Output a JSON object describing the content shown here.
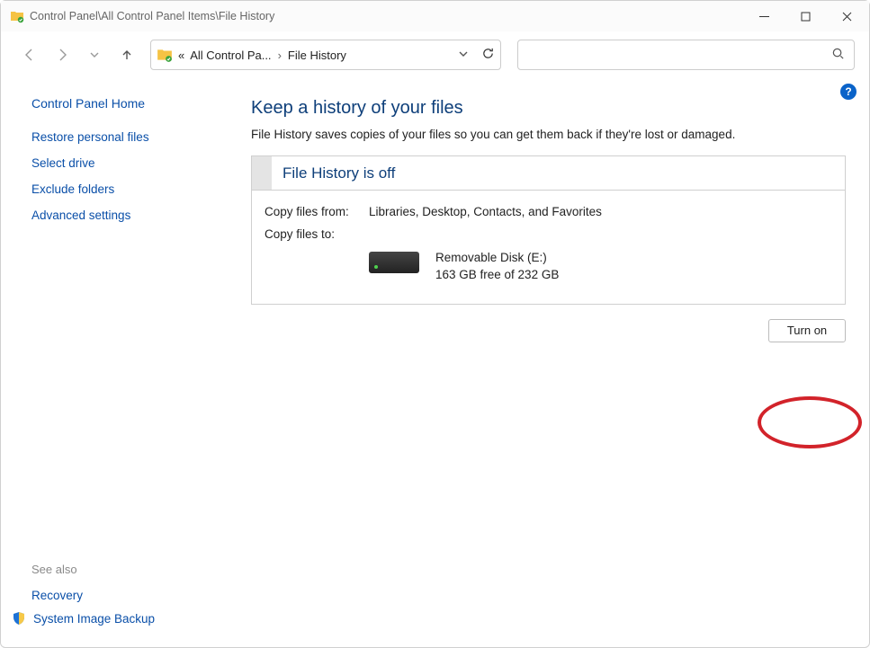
{
  "window": {
    "title": "Control Panel\\All Control Panel Items\\File History"
  },
  "breadcrumb": {
    "prefix": "«",
    "item1": "All Control Pa...",
    "item2": "File History"
  },
  "search": {
    "placeholder": ""
  },
  "sidebar": {
    "home": "Control Panel Home",
    "links": {
      "restore": "Restore personal files",
      "select_drive": "Select drive",
      "exclude": "Exclude folders",
      "advanced": "Advanced settings"
    },
    "see_also_label": "See also",
    "see_also": {
      "recovery": "Recovery",
      "sib": "System Image Backup"
    }
  },
  "content": {
    "heading": "Keep a history of your files",
    "description": "File History saves copies of your files so you can get them back if they're lost or damaged.",
    "status": "File History is off",
    "copy_from_label": "Copy files from:",
    "copy_from_value": "Libraries, Desktop, Contacts, and Favorites",
    "copy_to_label": "Copy files to:",
    "drive_name": "Removable Disk (E:)",
    "drive_free": "163 GB free of 232 GB",
    "turn_on": "Turn on"
  }
}
